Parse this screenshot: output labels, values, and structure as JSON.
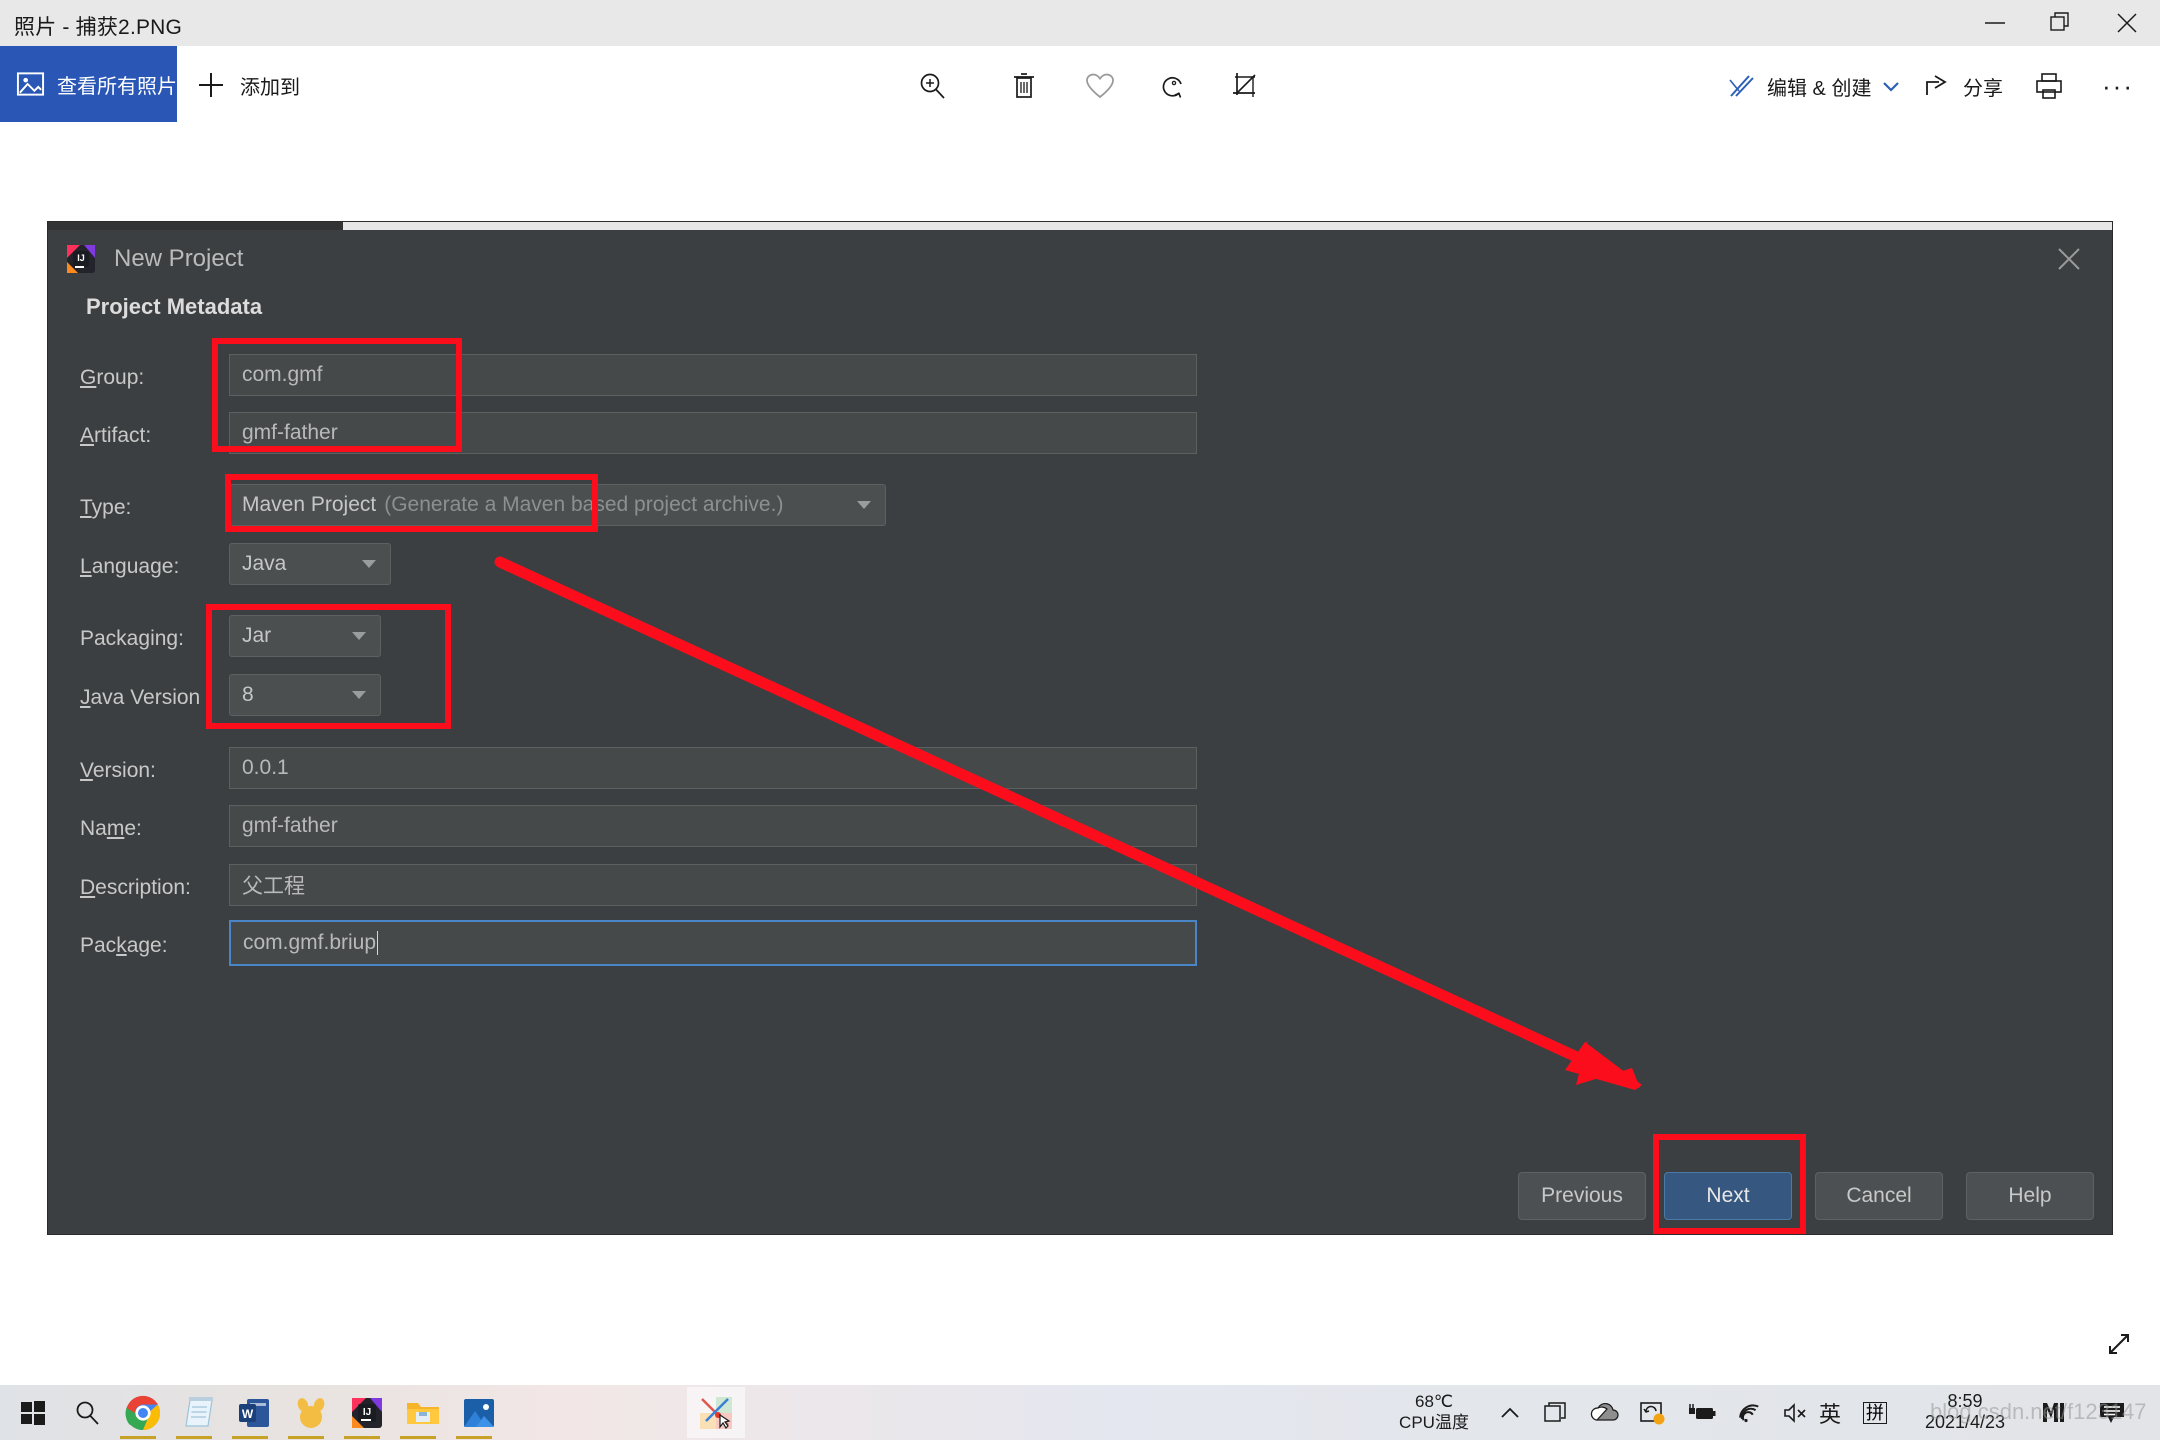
{
  "window": {
    "title": "照片 - 捕获2.PNG",
    "controls": {
      "minimize": "minimize-icon",
      "maximize": "restore-icon",
      "close": "close-icon"
    }
  },
  "toolbar": {
    "view_all_label": "查看所有照片",
    "view_all_icon": "photo-icon",
    "add_to_label": "添加到",
    "add_to_icon": "plus-icon",
    "zoom_icon": "zoom-in-icon",
    "delete_icon": "trash-icon",
    "favorite_icon": "heart-icon",
    "rotate_icon": "rotate-icon",
    "crop_icon": "crop-icon",
    "edit_create_label": "编辑 & 创建",
    "edit_create_icon": "edit-create-icon",
    "edit_create_chevron": "chevron-down-icon",
    "share_label": "分享",
    "share_icon": "share-icon",
    "print_icon": "print-icon",
    "more_label": "···",
    "expand_icon": "fullscreen-icon"
  },
  "dialog": {
    "title": "New Project",
    "app_icon": "intellij-idea-icon",
    "close_icon": "close-icon",
    "section_heading": "Project Metadata",
    "fields": [
      {
        "label": "Group:",
        "mnemonic": "G",
        "value": "com.gmf",
        "kind": "text"
      },
      {
        "label": "Artifact:",
        "mnemonic": "A",
        "value": "gmf-father",
        "kind": "text"
      },
      {
        "label": "Type:",
        "mnemonic": "T",
        "value": "Maven Project",
        "hint": "(Generate a Maven based project archive.)",
        "kind": "combo"
      },
      {
        "label": "Language:",
        "mnemonic": "L",
        "value": "Java",
        "kind": "combo"
      },
      {
        "label": "Packaging:",
        "mnemonic": "g",
        "value": "Jar",
        "kind": "combo"
      },
      {
        "label": "Java Version",
        "mnemonic": "J",
        "value": "8",
        "kind": "combo"
      },
      {
        "label": "Version:",
        "mnemonic": "V",
        "value": "0.0.1",
        "kind": "text"
      },
      {
        "label": "Name:",
        "mnemonic": "m",
        "value": "gmf-father",
        "kind": "text"
      },
      {
        "label": "Description:",
        "mnemonic": "D",
        "value": "父工程",
        "kind": "text"
      },
      {
        "label": "Package:",
        "mnemonic": "k",
        "value": "com.gmf.briup",
        "kind": "text",
        "focused": true
      }
    ],
    "buttons": {
      "previous": "Previous",
      "next": "Next",
      "cancel": "Cancel",
      "help": "Help"
    }
  },
  "annotations": {
    "color": "#fc0d1b",
    "boxes": [
      "group-artifact-highlight",
      "type-highlight",
      "packaging-javaversion-highlight",
      "next-button-highlight"
    ],
    "arrow": "red-arrow-pointing-to-next"
  },
  "taskbar": {
    "items": [
      {
        "name": "start-button",
        "icon": "windows-logo-icon"
      },
      {
        "name": "search-button",
        "icon": "search-icon"
      },
      {
        "name": "chrome",
        "icon": "chrome-icon"
      },
      {
        "name": "notepad",
        "icon": "notepad-icon"
      },
      {
        "name": "word",
        "icon": "word-icon"
      },
      {
        "name": "app-orange",
        "icon": "orange-app-icon"
      },
      {
        "name": "intellij-idea",
        "icon": "intellij-idea-icon"
      },
      {
        "name": "file-explorer",
        "icon": "folder-icon"
      },
      {
        "name": "photos",
        "icon": "photos-icon"
      },
      {
        "name": "photos-active",
        "icon": "paint-icon"
      }
    ],
    "cpu_temp_value": "68℃",
    "cpu_temp_label": "CPU温度",
    "tray": [
      {
        "name": "show-hidden-icons",
        "icon": "chevron-up-icon"
      },
      {
        "name": "task-view",
        "icon": "windows-copy-icon"
      },
      {
        "name": "onedrive",
        "icon": "cloud-icon"
      },
      {
        "name": "sync-status",
        "icon": "sync-icon"
      },
      {
        "name": "battery",
        "icon": "battery-charging-icon"
      },
      {
        "name": "network",
        "icon": "wifi-icon"
      },
      {
        "name": "volume",
        "icon": "speaker-mute-icon"
      }
    ],
    "ime_language": "英",
    "ime_mode": "拼",
    "time": "8:59",
    "date": "2021/4/23",
    "extra_icons": [
      {
        "name": "m-app",
        "icon": "m-logo-icon"
      },
      {
        "name": "notification-center",
        "icon": "notification-icon"
      }
    ]
  },
  "watermark": "blog.csdn.net/f123147"
}
